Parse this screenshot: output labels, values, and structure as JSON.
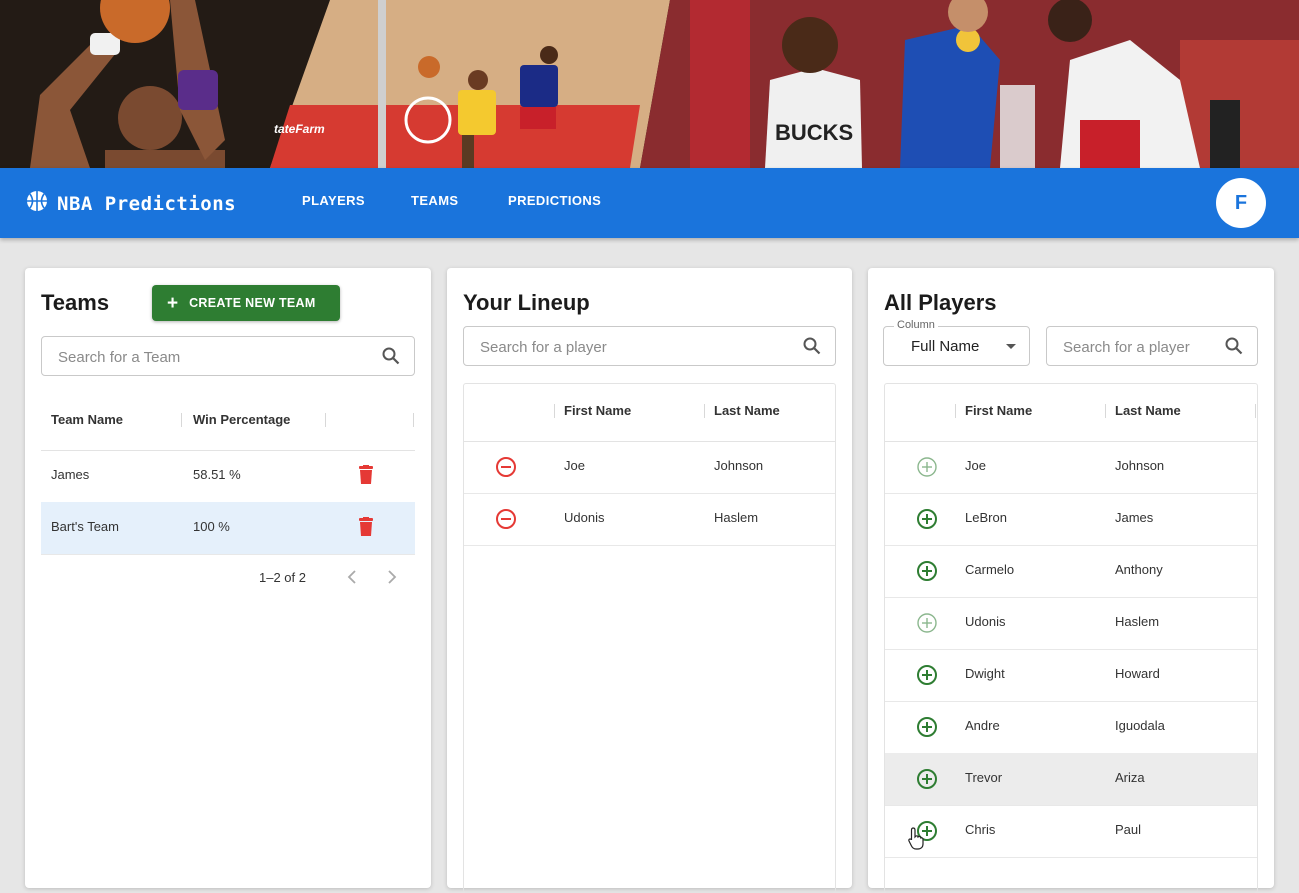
{
  "app": {
    "title": "NBA Predictions",
    "brand_icon": "basketball-icon",
    "accent_color": "#1a74dc",
    "nav": [
      "PLAYERS",
      "TEAMS",
      "PREDICTIONS"
    ],
    "avatar_initial": "F",
    "banner_sign": "tateFarm",
    "jersey_text": "BUCKS"
  },
  "teams_panel": {
    "title": "Teams",
    "create_button": "CREATE NEW TEAM",
    "create_icon": "plus-icon",
    "search_placeholder": "Search for a Team",
    "columns": [
      "Team Name",
      "Win Percentage"
    ],
    "rows": [
      {
        "name": "James",
        "win": "58.51 %"
      },
      {
        "name": "Bart's Team",
        "win": "100 %",
        "selected": true
      }
    ],
    "delete_icon": "trash-icon",
    "delete_color": "#e53935",
    "pagination": "1–2 of 2"
  },
  "lineup_panel": {
    "title": "Your Lineup",
    "search_placeholder": "Search for a player",
    "columns": [
      "First Name",
      "Last Name"
    ],
    "rows": [
      {
        "first": "Joe",
        "last": "Johnson"
      },
      {
        "first": "Udonis",
        "last": "Haslem"
      }
    ],
    "remove_icon": "remove-circle-icon",
    "remove_color": "#e53935"
  },
  "players_panel": {
    "title": "All Players",
    "column_select": {
      "label": "Column",
      "value": "Full Name"
    },
    "search_placeholder": "Search for a player",
    "columns": [
      "First Name",
      "Last Name"
    ],
    "rows": [
      {
        "first": "Joe",
        "last": "Johnson",
        "disabled": true
      },
      {
        "first": "LeBron",
        "last": "James"
      },
      {
        "first": "Carmelo",
        "last": "Anthony"
      },
      {
        "first": "Udonis",
        "last": "Haslem",
        "disabled": true
      },
      {
        "first": "Dwight",
        "last": "Howard"
      },
      {
        "first": "Andre",
        "last": "Iguodala"
      },
      {
        "first": "Trevor",
        "last": "Ariza",
        "hovered": true
      },
      {
        "first": "Chris",
        "last": "Paul"
      }
    ],
    "add_icon": "add-circle-icon",
    "add_color": "#2e7d32"
  }
}
